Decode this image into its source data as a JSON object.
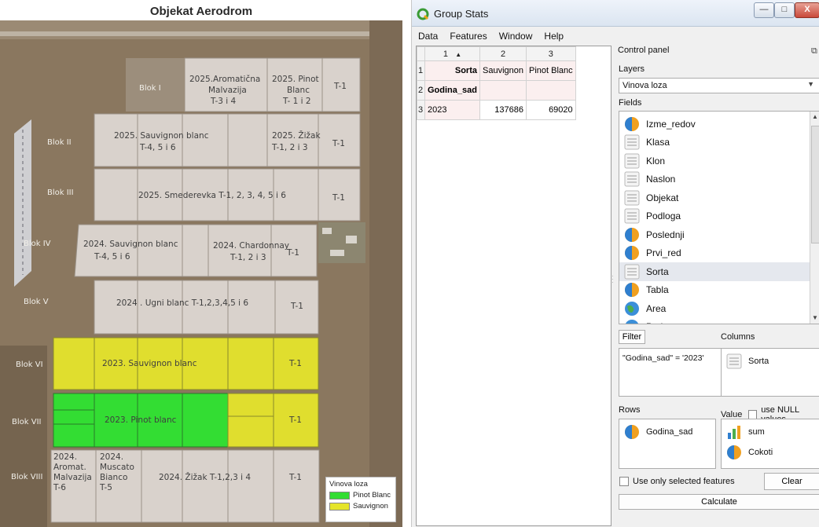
{
  "map": {
    "title": "Objekat Aerodrom",
    "bloks": [
      "Blok I",
      "Blok II",
      "Blok III",
      "Blok IV",
      "Blok V",
      "Blok VI",
      "Blok VII",
      "Blok VIII"
    ],
    "labels": {
      "b1_a": "2025.Aromatična",
      "b1_b": "Malvazija",
      "b1_c": "T-3 i 4",
      "b1_d": "2025. Pinot",
      "b1_e": "Blanc",
      "b1_f": "T- 1 i 2",
      "b1_g": "T-1",
      "b2_a": "2025. Sauvignon blanc",
      "b2_b": "T-4, 5 i 6",
      "b2_c": "2025. Žižak",
      "b2_d": "T-1, 2 i 3",
      "b2_e": "T-1",
      "b3_a": "2025. Smederevka T-1, 2, 3, 4, 5 i 6",
      "b3_b": "T-1",
      "b4_a": "2024. Sauvignon blanc",
      "b4_b": "T-4, 5 i 6",
      "b4_c": "2024. Chardonnay",
      "b4_d": "T-1, 2 i 3",
      "b4_e": "T-1",
      "b5_a": "2024 . Ugni blanc T-1,2,3,4,5 i 6",
      "b5_b": "T-1",
      "b6_a": "2023. Sauvignon blanc",
      "b6_b": "T-1",
      "b7_a": "2023. Pinot blanc",
      "b7_b": "T-1",
      "b8_a": "2024.",
      "b8_b": "Aromat.",
      "b8_c": "Malvazija",
      "b8_d": "T-6",
      "b8_e": "2024.",
      "b8_f": "Muscato",
      "b8_g": "Bianco",
      "b8_h": "T-5",
      "b8_i": "2024. Žižak T-1,2,3 i 4",
      "b8_j": "T-1"
    },
    "legend": {
      "title": "Vinova loza",
      "items": [
        {
          "label": "Pinot Blanc",
          "color": "#33dd33"
        },
        {
          "label": "Sauvignon",
          "color": "#e5e52a"
        }
      ]
    },
    "colors": {
      "grey": "#d9d2cc",
      "green": "#33dd33",
      "yellow": "#e0de2e",
      "ground": "#8e7b65"
    }
  },
  "dialog": {
    "title": "Group Stats",
    "window_buttons": {
      "min": "—",
      "max": "□",
      "close": "X"
    },
    "menu": [
      "Data",
      "Features",
      "Window",
      "Help"
    ],
    "table": {
      "col_headers": [
        "1",
        "2",
        "3"
      ],
      "sort_marker": "▲",
      "row_numbers": [
        "1",
        "2",
        "3"
      ],
      "rows": [
        [
          "Sorta",
          "Sauvignon",
          "Pinot Blanc"
        ],
        [
          "Godina_sad",
          "",
          ""
        ],
        [
          "2023",
          "137686",
          "69020"
        ]
      ]
    },
    "control": {
      "title": "Control panel",
      "layers_label": "Layers",
      "layer_value": "Vinova loza",
      "fields_label": "Fields",
      "fields": [
        {
          "name": "Izme_redov",
          "icon": "decimal-icon"
        },
        {
          "name": "Klasa",
          "icon": "text-icon"
        },
        {
          "name": "Klon",
          "icon": "text-icon"
        },
        {
          "name": "Naslon",
          "icon": "text-icon"
        },
        {
          "name": "Objekat",
          "icon": "text-icon"
        },
        {
          "name": "Podloga",
          "icon": "text-icon"
        },
        {
          "name": "Poslednji",
          "icon": "decimal-icon"
        },
        {
          "name": "Prvi_red",
          "icon": "decimal-icon"
        },
        {
          "name": "Sorta",
          "icon": "text-icon"
        },
        {
          "name": "Tabla",
          "icon": "decimal-icon"
        },
        {
          "name": "Area",
          "icon": "globe-icon"
        },
        {
          "name": "Perimet",
          "icon": "globe-icon"
        }
      ],
      "selected_field": "Sorta",
      "filter_button": "Filter",
      "filter_expression": "\"Godina_sad\" = '2023'",
      "columns_label": "Columns",
      "columns_items": [
        "Sorta"
      ],
      "rows_label": "Rows",
      "rows_items": [
        "Godina_sad"
      ],
      "value_label": "Value",
      "use_null_label": "use NULL values",
      "value_items": [
        "sum",
        "Cokoti"
      ],
      "use_selected_label": "Use only selected features",
      "clear_button": "Clear",
      "calculate_button": "Calculate"
    }
  }
}
